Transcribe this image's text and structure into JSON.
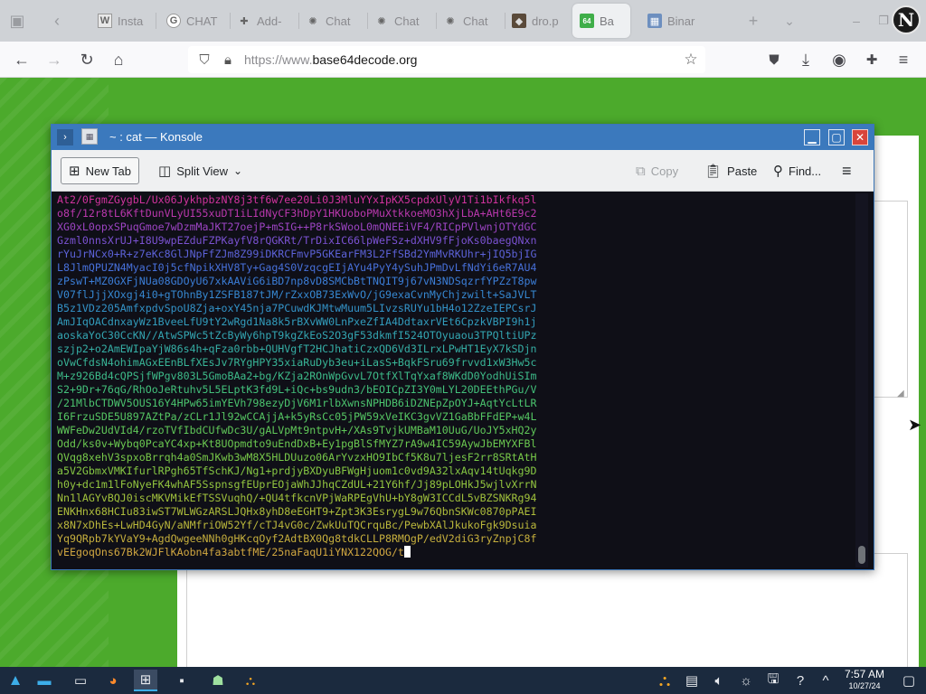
{
  "browser": {
    "tabs": [
      {
        "label": "Insta",
        "icon": "W",
        "active": false
      },
      {
        "label": "CHAT",
        "icon": "G",
        "active": false
      },
      {
        "label": "Add-",
        "icon": "puzzle",
        "active": false
      },
      {
        "label": "Chat",
        "icon": "openai",
        "active": false
      },
      {
        "label": "Chat",
        "icon": "openai",
        "active": false
      },
      {
        "label": "Chat",
        "icon": "openai",
        "active": false
      },
      {
        "label": "dro.p",
        "icon": "dot",
        "active": false
      },
      {
        "label": "Ba",
        "icon": "64",
        "active": true
      },
      {
        "label": "Binar",
        "icon": "grid",
        "active": false
      }
    ],
    "url_scheme": "https://www.",
    "url_domain": "base64decode.org",
    "profile_initial": "N"
  },
  "konsole": {
    "title": "~ : cat — Konsole",
    "toolbar": {
      "new_tab": "New Tab",
      "split_view": "Split View",
      "copy": "Copy",
      "paste": "Paste",
      "find": "Find..."
    },
    "lines": [
      "At2/0FgmZGygbL/Ux06JykhpbzNY8j3tf6w7ee20Li0J3MluYYxIpKX5cpdxUlyV1Ti1bIkfkq5l",
      "o8f/12r8tL6KftDunVLyUI55xuDT1iLIdNyCF3hDpY1HKUoboPMuXtkkoeMO3hXjLbA+AHt6E9c2",
      "XG0xL0opxSPuqGmoe7wDzmMaJKT27oejP+mSIG++P8rkSWooL0mQNEEiVF4/RICpPVlwnjOTYdGC",
      "Gzml0nnsXrUJ+I8U9wpEZduFZPKayfV8rQGKRt/TrDixIC66lpWeFSz+dXHV9fFjoKs0baegQNxn",
      "rYuJrNCx0+R+z7eKc8GlJNpFfZJm8Z99iDKRCFmvP5GKEarFM3L2FfSBd2YmMvRKUhr+jIQ5bjIG",
      "L8JlmQPUZN4MyacI0j5cfNpikXHV8Ty+Gag4S0VzqcgEIjAYu4PyY4ySuhJPmDvLfNdYi6eR7AU4",
      "zPswT+MZ0GXFjNUa08GDOyU67xkAAViG6iBD7np8vD8SMCbBtTNQIT9j67vN3NDSqzrfYPZzT8pw",
      "V07flJjjXOxgj4i0+gTOhnBy1ZSFB187tJM/rZxxOB73ExWvO/jG9exaCvnMyChjzwilt+SaJVLT",
      "B5z1VDz205AmfxpdvSpoU8Zja+oxY45nja7PCuwdKJMtwMuum5LIvzsRUYu1bH4o12ZzeIEPCsrJ",
      "AmJIqOACdnxayWz1BveeLfU9tY2wRgd1Na8k5rBXvWW0LnPxeZfIA4DdtaxrVEt6CpzkVBPI9h1j",
      "aoskaYoC30CcKN//AtwSPWc5tZcByWy6hpT9kgZkEoS2O3gF53dkmfI524OTOyuaou3TPQltiUPz",
      "szjp2+o2AmEWIpaYjW86s4h+qFza0rbb+QUHVgfT2HCJhatiCzxQD6Vd3ILrxLPwHT1EyX7kSDjn",
      "oVwCfdsN4ohimAGxEEnBLfXEsJv7RYgHPY35xiaRuDyb3eu+iLasS+BqkFSru69frvvd1xW3Hw5c",
      "M+z926Bd4cQPSjfWPgv803L5GmoBAa2+bg/KZja2ROnWpGvvL7OtfXlTqYxaf8WKdD0YodhUiSIm",
      "S2+9Dr+76qG/RhOoJeRtuhv5L5ELptK3fd9L+iQc+bs9udn3/bEOICpZI3Y0mLYL20DEEthPGu/V",
      "/21MlbCTDWV5OUS16Y4HPw65imYEVh798ezyDjV6M1rlbXwnsNPHDB6iDZNEpZpOYJ+AqtYcLtLR",
      "I6FrzuSDE5U897AZtPa/zCLr1Jl92wCCAjjA+k5yRsCc05jPW59xVeIKC3gvVZ1GaBbFFdEP+w4L",
      "WWFeDw2UdVId4/rzoTVfIbdCUfwDc3U/gALVpMt9ntpvH+/XAs9TvjkUMBaM10UuG/UoJY5xHQ2y",
      "Odd/ks0v+Wybq0PcaYC4xp+Kt8UOpmdto9uEndDxB+Ey1pgBlSfMYZ7rA9w4IC59AywJbEMYXFBl",
      "QVqg8xehV3spxoBrrqh4a0SmJKwb3wM8X5HLDUuzo06ArYvzxHO9IbCf5K8u7ljesF2rr8SRtAtH",
      "a5V2GbmxVMKIfurlRPgh65TfSchKJ/Ng1+prdjyBXDyuBFWgHjuom1c0vd9A32lxAqv14tUqkg9D",
      "h0y+dc1m1lFoNyeFK4whAF5SspnsgfEUprEOjaWhJJhqCZdUL+21Y6hf/Jj89pLOHkJ5wjlvXrrN",
      "Nn1lAGYvBQJ0iscMKVMikEfTSSVuqhQ/+QU4tfkcnVPjWaRPEgVhU+bY8gW3ICCdL5vBZSNKRg94",
      "ENKHnx68HCIu83iwST7WLWGzARSLJQHx8yhD8eEGHT9+Zpt3K3EsrygL9w76QbnSKWc0870pPAEI",
      "x8N7xDhEs+LwHD4GyN/aNMfriOW52Yf/cTJ4vG0c/ZwkUuTQCrquBc/PewbXAlJkukoFgk9Dsuia",
      "Yq9QRpb7kYVaY9+AgdQwgeeNNh0gHKcqOyf2AdtBX0Qg8tdkCLLP8RMOgP/edV2diG3ryZnpjC8f",
      "vEEgoqOns67Bk2WJFlKAobn4fa3abtfME/25naFaqU1iYNX122QOG/t"
    ],
    "line_colors": [
      "#d0339d",
      "#ba38ad",
      "#9c44c3",
      "#7a52d2",
      "#5c62d8",
      "#4770da",
      "#3b7ed8",
      "#3688d1",
      "#3393c8",
      "#329dbd",
      "#33a6b2",
      "#35aea5",
      "#38b597",
      "#3dbb89",
      "#43c07b",
      "#4bc46e",
      "#55c663",
      "#60c859",
      "#6bc950",
      "#78c949",
      "#86c843",
      "#93c63f",
      "#a1c23c",
      "#aebd3b",
      "#bab73b",
      "#c6af3d",
      "#d1a740",
      "#dc9d45"
    ]
  },
  "taskbar": {
    "time": "7:57 AM",
    "date": "10/27/24"
  }
}
